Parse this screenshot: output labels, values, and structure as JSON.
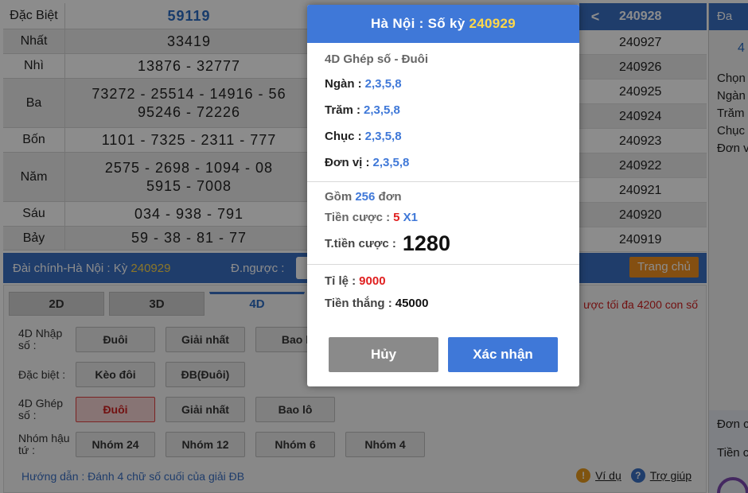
{
  "results": [
    {
      "name": "Đặc Biệt",
      "values": "59119"
    },
    {
      "name": "Nhất",
      "values": "33419"
    },
    {
      "name": "Nhì",
      "values": "13876 - 32777"
    },
    {
      "name": "Ba",
      "values": "73272 - 25514 - 14916 - 56\n95246 - 72226"
    },
    {
      "name": "Bốn",
      "values": "1101 - 7325 - 2311 - 777"
    },
    {
      "name": "Năm",
      "values": "2575 - 2698 - 1094 - 08\n5915 - 7008"
    },
    {
      "name": "Sáu",
      "values": "034 - 938 - 791"
    },
    {
      "name": "Bảy",
      "values": "59 - 38 - 81 - 77"
    }
  ],
  "ky_list": {
    "header_arrow": "<",
    "header": "240928",
    "items": [
      "240927",
      "240926",
      "240925",
      "240924",
      "240923",
      "240922",
      "240921",
      "240920",
      "240919"
    ]
  },
  "sidebar": {
    "top": "Đa",
    "blue": "4",
    "lines": [
      "Chọn",
      "Ngàn",
      "Trăm",
      "Chục",
      "Đơn v"
    ],
    "bottom": [
      "Đơn c",
      "Tiền c"
    ]
  },
  "info_bar": {
    "dai_label": "Đài chính-Hà Nội  :  Kỳ",
    "ky": "240929",
    "dnguoc": "Đ.ngược :",
    "home": "Trang chủ"
  },
  "tabs": [
    "2D",
    "3D",
    "4D"
  ],
  "max_note": "ược tối đa 4200 con số",
  "option_rows": [
    {
      "label": "4D Nhập số :",
      "buttons": [
        "Đuôi",
        "Giải nhất",
        "Bao l"
      ]
    },
    {
      "label": "Đặc biệt :",
      "buttons": [
        "Kèo đôi",
        "ĐB(Đuôi)"
      ]
    },
    {
      "label": "4D Ghép số :",
      "buttons": [
        "Đuôi",
        "Giải nhất",
        "Bao lô"
      ]
    },
    {
      "label": "Nhóm hậu tứ :",
      "buttons": [
        "Nhóm 24",
        "Nhóm 12",
        "Nhóm 6",
        "Nhóm 4"
      ]
    }
  ],
  "guide": "Hướng dẫn : Đánh 4 chữ số cuối của giải ĐB",
  "help": {
    "example": "Ví dụ",
    "help": "Trợ giúp",
    "warn_icon": "!",
    "q_icon": "?"
  },
  "modal": {
    "title": "Hà Nội : Số kỳ",
    "ky": "240929",
    "type": "4D Ghép số - Đuôi",
    "lines": [
      {
        "label": "Ngàn :",
        "value": "2,3,5,8"
      },
      {
        "label": "Trăm :",
        "value": "2,3,5,8"
      },
      {
        "label": "Chục :",
        "value": "2,3,5,8"
      },
      {
        "label": "Đơn vị :",
        "value": "2,3,5,8"
      }
    ],
    "gom_label": "Gồm",
    "gom_value": "256",
    "gom_unit": "đơn",
    "tien_cuoc_label": "Tiền cược :",
    "tien_cuoc_value": "5",
    "multiplier": "X1",
    "total_label": "T.tiền cược :",
    "total_value": "1280",
    "ti_le_label": "Tỉ lệ :",
    "ti_le_value": "9000",
    "tien_thang_label": "Tiền thắng :",
    "tien_thang_value": "45000",
    "cancel": "Hủy",
    "confirm": "Xác nhận"
  },
  "colors": {
    "primary": "#3f78d8",
    "accent": "#ffd84a",
    "red": "#e02020",
    "orange": "#f09020"
  }
}
